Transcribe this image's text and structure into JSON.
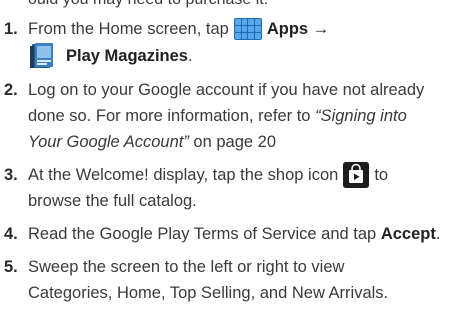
{
  "top_fragment": "ould you may need to purchase it.",
  "steps": [
    {
      "num": "1.",
      "a": "From the Home screen, tap",
      "b": "Apps →",
      "c": "Play Magazines",
      "d": "."
    },
    {
      "num": "2.",
      "l1": "Log on to your Google account if you have not already",
      "l2": "done so. For more information, refer to",
      "l2i": "“Signing into",
      "l3i": "Your Google Account”",
      "l3": "on page 20"
    },
    {
      "num": "3.",
      "a": "At the Welcome! display, tap the shop icon",
      "b": "to",
      "l2": "browse the full catalog."
    },
    {
      "num": "4.",
      "a": "Read the Google Play Terms of Service and tap",
      "b": "Accept",
      "c": "."
    },
    {
      "num": "5.",
      "l1": "Sweep the screen to the left or right to view",
      "l2": "Categories, Home, Top Selling, and New Arrivals."
    }
  ],
  "icons": {
    "apps": "apps-grid-icon",
    "magazines": "play-magazines-icon",
    "shop": "play-store-shop-icon"
  },
  "colors": {
    "apps_icon_bg": "#1f6fb8",
    "apps_icon_cell": "#5aa6ea",
    "shop_icon_bg": "#1d1d1d",
    "text": "#3a3a3a"
  }
}
